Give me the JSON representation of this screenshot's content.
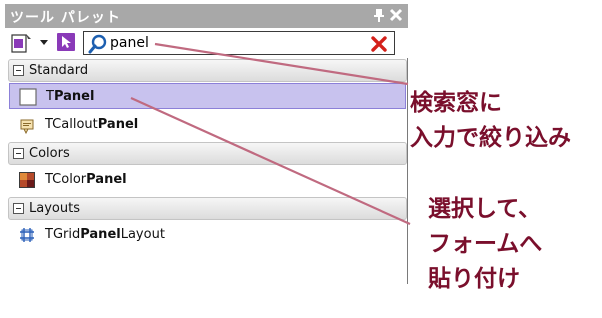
{
  "palette": {
    "title": "ツール パレット",
    "search": {
      "value": "panel"
    },
    "sections": [
      {
        "label": "Standard",
        "items": [
          {
            "prefix": "T",
            "match": "Panel",
            "suffix": "",
            "selected": true,
            "icon": "panel-icon"
          },
          {
            "prefix": "TCallout",
            "match": "Panel",
            "suffix": "",
            "selected": false,
            "icon": "callout-panel-icon"
          }
        ]
      },
      {
        "label": "Colors",
        "items": [
          {
            "prefix": "TColor",
            "match": "Panel",
            "suffix": "",
            "selected": false,
            "icon": "color-panel-icon"
          }
        ]
      },
      {
        "label": "Layouts",
        "items": [
          {
            "prefix": "TGrid",
            "match": "Panel",
            "suffix": "Layout",
            "selected": false,
            "icon": "grid-panel-layout-icon"
          }
        ]
      }
    ]
  },
  "annotations": {
    "search_note": [
      "検索窓に",
      "入力で絞り込み"
    ],
    "drag_note": [
      "選択して、",
      "フォームへ",
      "貼り付け"
    ]
  },
  "colors": {
    "title_bar": "#a8a8a8",
    "selected_row": "#c8c2ee",
    "annotation": "#7a0f2c",
    "leader_line": "#c06a80",
    "clear_icon": "#d4201a"
  }
}
